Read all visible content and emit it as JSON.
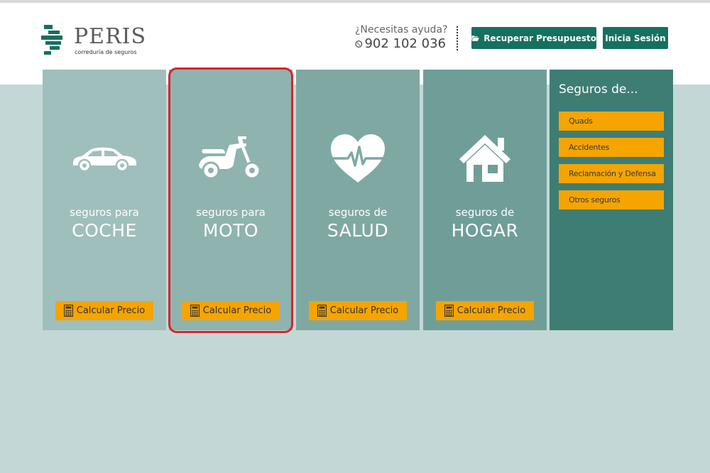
{
  "brand": {
    "name": "PERIS",
    "tagline": "correduría de seguros",
    "mark_color": "#16705f"
  },
  "help": {
    "question": "¿Necesitas ayuda?",
    "phone": "902 102 036",
    "phone_icon": "phone-icon"
  },
  "header_buttons": {
    "recover_label": "Recuperar Presupuesto",
    "recover_icon": "folder-open-icon",
    "login_label": "Inicia Sesión"
  },
  "cards": [
    {
      "small": "seguros para",
      "big": "COCHE",
      "icon": "car-icon",
      "button": "Calcular Precio",
      "bg": "#9fbfbc"
    },
    {
      "small": "seguros para",
      "big": "MOTO",
      "icon": "scooter-icon",
      "button": "Calcular Precio",
      "bg": "#8fb3af"
    },
    {
      "small": "seguros de",
      "big": "SALUD",
      "icon": "heart-pulse-icon",
      "button": "Calcular Precio",
      "bg": "#7fa8a3"
    },
    {
      "small": "seguros de",
      "big": "HOGAR",
      "icon": "house-icon",
      "button": "Calcular Precio",
      "bg": "#6f9e99"
    }
  ],
  "sidebar": {
    "title": "Seguros de...",
    "links": [
      "Quads",
      "Accidentes",
      "Reclamación y Defensa",
      "Otros seguros"
    ]
  },
  "colors": {
    "accent": "#f5a400",
    "primary": "#16705f",
    "page_bg": "#c3d8d6",
    "sidebar_bg": "#3e7d74",
    "highlight": "#d8242f"
  }
}
